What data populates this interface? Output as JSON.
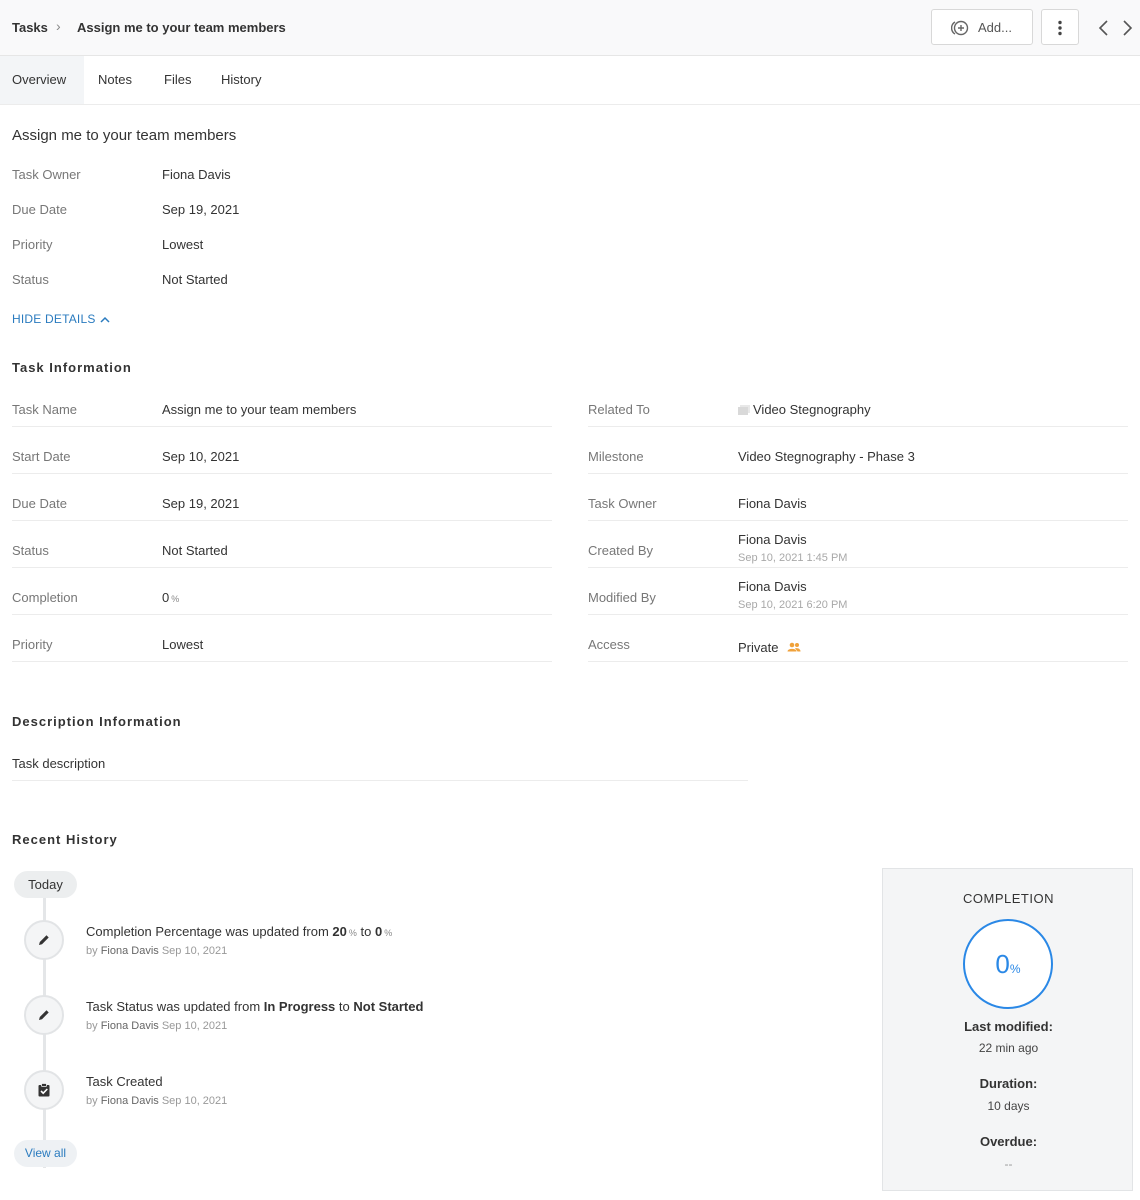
{
  "header": {
    "breadcrumb_root": "Tasks",
    "breadcrumb_current": "Assign me to your team members",
    "add_label": "Add..."
  },
  "tabs": [
    "Overview",
    "Notes",
    "Files",
    "History"
  ],
  "title": "Assign me to your team members",
  "summary": [
    {
      "label": "Task Owner",
      "value": "Fiona Davis"
    },
    {
      "label": "Due Date",
      "value": "Sep 19, 2021"
    },
    {
      "label": "Priority",
      "value": "Lowest"
    },
    {
      "label": "Status",
      "value": "Not Started"
    }
  ],
  "hide_details": "HIDE DETAILS",
  "task_info": {
    "title": "Task Information",
    "left": [
      {
        "label": "Task Name",
        "value": "Assign me to your team members"
      },
      {
        "label": "Start Date",
        "value": "Sep 10, 2021"
      },
      {
        "label": "Due Date",
        "value": "Sep 19, 2021"
      },
      {
        "label": "Status",
        "value": "Not Started"
      },
      {
        "label": "Completion",
        "value": "0",
        "unit": "%"
      },
      {
        "label": "Priority",
        "value": "Lowest"
      }
    ],
    "right": [
      {
        "label": "Related To",
        "value": "Video Stegnography"
      },
      {
        "label": "Milestone",
        "value": "Video Stegnography - Phase 3"
      },
      {
        "label": "Task Owner",
        "value": "Fiona Davis"
      },
      {
        "label": "Created By",
        "value": "Fiona Davis",
        "sub": "Sep 10, 2021 1:45 PM"
      },
      {
        "label": "Modified By",
        "value": "Fiona Davis",
        "sub": "Sep 10, 2021 6:20 PM"
      },
      {
        "label": "Access",
        "value": "Private"
      }
    ]
  },
  "description": {
    "title": "Description Information",
    "text": "Task description"
  },
  "history": {
    "title": "Recent History",
    "day": "Today",
    "view_all": "View all",
    "items": [
      {
        "text_a": "Completion Percentage was updated from ",
        "from": "20",
        "mid": " to ",
        "to": "0",
        "unit": "%",
        "by": "by",
        "name": "Fiona Davis",
        "date": "Sep 10, 2021"
      },
      {
        "text_a": "Task Status was updated from ",
        "from": "In Progress",
        "mid": " to ",
        "to": "Not Started",
        "by": "by",
        "name": "Fiona Davis",
        "date": "Sep 10, 2021"
      },
      {
        "text_a": "Task Created",
        "by": "by",
        "name": "Fiona Davis",
        "date": "Sep 10, 2021"
      }
    ]
  },
  "completion_card": {
    "title": "COMPLETION",
    "percent": "0",
    "unit": "%",
    "last_modified_label": "Last modified:",
    "last_modified": "22 min ago",
    "duration_label": "Duration:",
    "duration": "10 days",
    "overdue_label": "Overdue:",
    "overdue": "--"
  },
  "colors": {
    "accent": "#2a88e6",
    "link": "#2a7bbf",
    "access_icon": "#f0a23b"
  }
}
